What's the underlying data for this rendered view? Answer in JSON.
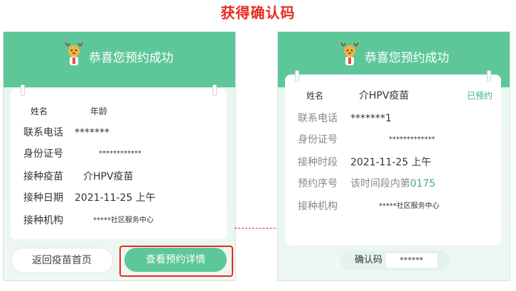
{
  "heading": "获得确认码",
  "left": {
    "title": "恭喜您预约成功",
    "rows": [
      {
        "label": "姓名",
        "value": "年龄"
      },
      {
        "label": "联系电话",
        "value": "*******"
      },
      {
        "label": "身份证号",
        "value": "************"
      },
      {
        "label": "接种疫苗",
        "value": "介HPV疫苗"
      },
      {
        "label": "接种日期",
        "value": "2021-11-25 上午"
      },
      {
        "label": "接种机构",
        "value": "*****社区服务中心"
      }
    ],
    "buttons": {
      "home": "返回疫苗首页",
      "detail": "查看预约详情"
    }
  },
  "right": {
    "title": "恭喜您预约成功",
    "rows": [
      {
        "label": "姓名",
        "value": "介HPV疫苗",
        "status": "已预约"
      },
      {
        "label": "联系电话",
        "value": "*******1"
      },
      {
        "label": "身份证号",
        "value": "*************"
      },
      {
        "label": "接种时段",
        "value": "2021-11-25 上午"
      },
      {
        "label": "预约序号",
        "value_prefix": "该时间段内第",
        "value_number": "0175"
      },
      {
        "label": "接种机构",
        "value": "*****社区服务中心"
      }
    ],
    "confirm": {
      "label": "确认码",
      "value": "******"
    }
  },
  "colors": {
    "brand_green": "#5ec79a",
    "accent_red": "#e8281e",
    "status_green": "#3fae7c"
  },
  "icons": {
    "mascot": "deer-mascot-icon",
    "connector": "arrow-right-icon"
  }
}
